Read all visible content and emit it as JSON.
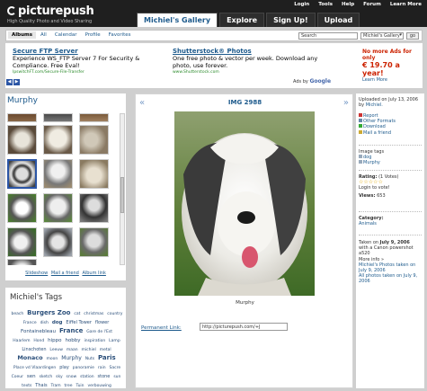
{
  "header": {
    "logo": "picturepush",
    "tagline": "High Quality Photo and Video Sharing",
    "topnav": [
      "Login",
      "Tools",
      "Help",
      "Forum",
      "Learn More"
    ],
    "tabs": [
      "Michiel's Gallery",
      "Explore",
      "Sign Up!",
      "Upload"
    ]
  },
  "subnav": {
    "tabs": [
      "Albums",
      "All",
      "Calendar",
      "Profile",
      "Favorites"
    ],
    "search_value": "Search",
    "scope_value": "Michiel's Gallery",
    "go_label": "go"
  },
  "ads": {
    "left": {
      "title": "Secure FTP Server",
      "body": "Experience WS_FTP Server 7 For Security & Compliance. Free Eval!",
      "url": "IpswitchFT.com/Secure-File-Transfer"
    },
    "right": {
      "title": "Shutterstock® Photos",
      "body": "One free photo & vector per week. Download any photo, use forever.",
      "url": "www.Shutterstock.com"
    },
    "ads_by": "Ads by",
    "ads_by_brand": "Google",
    "no_more_ads": "No more Ads for only",
    "price": "€ 19.70 a year!",
    "learn_more": "Learn More"
  },
  "left": {
    "album_title": "Murphy",
    "links": [
      "Slideshow",
      "Mail a friend",
      "Album link"
    ]
  },
  "tags": {
    "title": "Michiel's Tags",
    "items": [
      {
        "text": "beach",
        "size": 4.5
      },
      {
        "text": "Burgers Zoo",
        "size": 7,
        "bold": true
      },
      {
        "text": "cat",
        "size": 4.5
      },
      {
        "text": "christmas",
        "size": 4.5
      },
      {
        "text": "country France",
        "size": 4.5
      },
      {
        "text": "dish",
        "size": 4.5
      },
      {
        "text": "dog",
        "size": 5.5,
        "bold": true
      },
      {
        "text": "Eiffel Tower",
        "size": 5
      },
      {
        "text": "flower",
        "size": 5
      },
      {
        "text": "Fontainebleau",
        "size": 5.5
      },
      {
        "text": "France",
        "size": 7,
        "bold": true
      },
      {
        "text": "Gare de l'Est",
        "size": 4.5
      },
      {
        "text": "Haarlem",
        "size": 4.5
      },
      {
        "text": "Hond",
        "size": 4.5
      },
      {
        "text": "hippo",
        "size": 5.5
      },
      {
        "text": "hobby",
        "size": 5.5
      },
      {
        "text": "inspiration",
        "size": 4.5
      },
      {
        "text": "Lamp",
        "size": 4.5
      },
      {
        "text": "Linschoten",
        "size": 5
      },
      {
        "text": "Leeuw",
        "size": 4.5
      },
      {
        "text": "maan",
        "size": 4.5
      },
      {
        "text": "michiel",
        "size": 4.5
      },
      {
        "text": "metal",
        "size": 4.5
      },
      {
        "text": "Monaco",
        "size": 6.5,
        "bold": true
      },
      {
        "text": "moon",
        "size": 4.5
      },
      {
        "text": "Murphy",
        "size": 6
      },
      {
        "text": "Nuts",
        "size": 4.5
      },
      {
        "text": "Paris",
        "size": 7,
        "bold": true
      },
      {
        "text": "Place vd Vlaardingen",
        "size": 4.5
      },
      {
        "text": "play",
        "size": 5
      },
      {
        "text": "panoramie",
        "size": 4.5
      },
      {
        "text": "rain",
        "size": 4.5
      },
      {
        "text": "Sacre Coeur",
        "size": 4.5
      },
      {
        "text": "sen",
        "size": 5.5
      },
      {
        "text": "sketch",
        "size": 4.5
      },
      {
        "text": "sky",
        "size": 4.5
      },
      {
        "text": "snow",
        "size": 4.5
      },
      {
        "text": "station",
        "size": 4.5
      },
      {
        "text": "stone",
        "size": 5
      },
      {
        "text": "sun",
        "size": 4.5
      },
      {
        "text": "texts",
        "size": 4.5
      },
      {
        "text": "Thais",
        "size": 5
      },
      {
        "text": "Tram",
        "size": 4.5
      },
      {
        "text": "tree",
        "size": 4.5
      },
      {
        "text": "Tuin",
        "size": 4.5
      },
      {
        "text": "verbouwing",
        "size": 4.5
      }
    ]
  },
  "photo": {
    "title": "IMG 2988",
    "caption": "Murphy",
    "prev": "«",
    "next": "»",
    "permalink_label": "Permanent Link:",
    "permalink_value": "http://picturepush.com/+J"
  },
  "details": {
    "uploaded": "Uploaded on July 13, 2006",
    "by": "by",
    "owner": "Michiel.",
    "actions": [
      "Report",
      "Other Formats",
      "Download",
      "Mail a friend"
    ],
    "image_tags_label": "Image tags",
    "image_tags": [
      "dog",
      "Murphy"
    ],
    "rating_label": "Rating:",
    "rating_votes": "(1 Votes)",
    "rating_value": 0,
    "login_to_vote": "Login to vote!",
    "views_label": "Views:",
    "views": "653",
    "category_label": "Category:",
    "category": "Animals",
    "taken_prefix": "Taken on",
    "taken_date": "July 9, 2006",
    "taken_suffix": "with a Canon powershot a520",
    "more_info": "More info »",
    "michiels_taken": "Michiel's Photos taken on July 9, 2006",
    "all_taken": "All photos taken on July 9, 2006"
  },
  "colors": {
    "header_bg": "#1f1f1f",
    "link": "#1d5a8c",
    "page_bg": "#cfcfcf",
    "ad_price": "#cc2200"
  }
}
